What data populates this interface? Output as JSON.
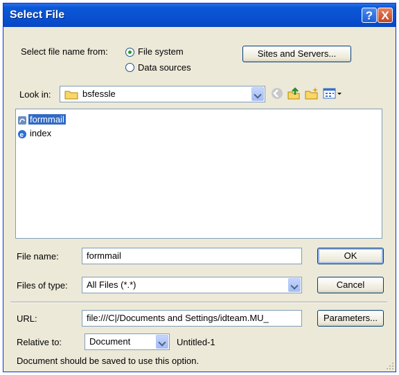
{
  "window": {
    "title": "Select File"
  },
  "titlebar": {
    "help_label": "?",
    "close_label": "X"
  },
  "source": {
    "label": "Select file name from:",
    "options": [
      {
        "label": "File system",
        "selected": true
      },
      {
        "label": "Data sources",
        "selected": false
      }
    ],
    "sites_button": "Sites and Servers..."
  },
  "look_in": {
    "label": "Look in:",
    "value": "bsfessle"
  },
  "toolbar": {
    "icons": [
      "back-icon",
      "up-folder-icon",
      "new-folder-icon",
      "view-menu-icon"
    ]
  },
  "files": [
    {
      "name": "formmail",
      "icon": "php-file-icon",
      "selected": true
    },
    {
      "name": "index",
      "icon": "html-file-icon",
      "selected": false
    }
  ],
  "file_name": {
    "label": "File name:",
    "value": "formmail"
  },
  "file_type": {
    "label": "Files of type:",
    "value": "All Files (*.*)"
  },
  "buttons": {
    "ok": "OK",
    "cancel": "Cancel",
    "parameters": "Parameters..."
  },
  "url": {
    "label": "URL:",
    "value": "file:///C|/Documents and Settings/idteam.MU_"
  },
  "relative": {
    "label": "Relative to:",
    "value": "Document",
    "doc_name": "Untitled-1"
  },
  "notice": "Document should be saved to use this option."
}
